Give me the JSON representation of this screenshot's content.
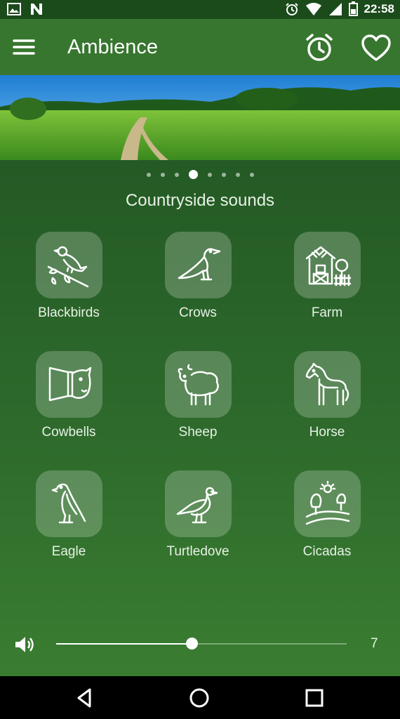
{
  "status_bar": {
    "time": "22:58",
    "left_icons": [
      "image-icon",
      "n-icon"
    ],
    "right_icons": [
      "alarm-icon",
      "wifi-icon",
      "signal-icon",
      "battery-icon"
    ]
  },
  "app_bar": {
    "title": "Ambience",
    "icons": [
      "menu-icon",
      "alarm-clock-icon",
      "heart-icon"
    ]
  },
  "pager": {
    "count": 8,
    "active_index": 3
  },
  "section_title": "Countryside sounds",
  "sounds": [
    {
      "label": "Blackbirds",
      "icon": "blackbird-icon"
    },
    {
      "label": "Crows",
      "icon": "crow-icon"
    },
    {
      "label": "Farm",
      "icon": "farm-icon"
    },
    {
      "label": "Cowbells",
      "icon": "cowbell-icon"
    },
    {
      "label": "Sheep",
      "icon": "sheep-icon"
    },
    {
      "label": "Horse",
      "icon": "horse-icon"
    },
    {
      "label": "Eagle",
      "icon": "eagle-icon"
    },
    {
      "label": "Turtledove",
      "icon": "turtledove-icon"
    },
    {
      "label": "Cicadas",
      "icon": "cicada-icon"
    }
  ],
  "volume": {
    "value": "7",
    "level": 0.465,
    "icon": "speaker-icon"
  },
  "nav_bar": {
    "icons": [
      "back-icon",
      "home-icon",
      "recents-icon"
    ]
  },
  "colors": {
    "status_bar": "#1b4a1b",
    "app_bar": "#37762f",
    "background": "#2e6b2c",
    "tile": "rgba(255,255,255,0.22)"
  }
}
